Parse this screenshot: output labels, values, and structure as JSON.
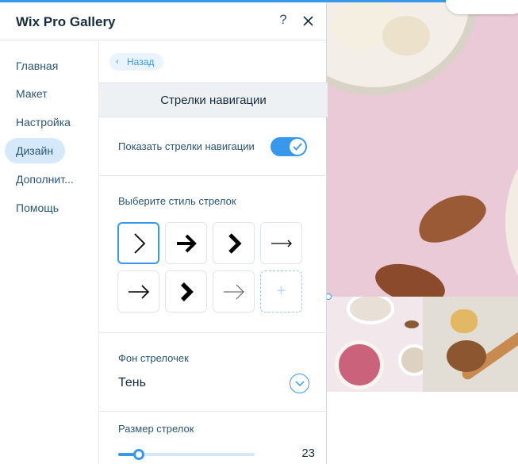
{
  "panel": {
    "title": "Wix Pro Gallery",
    "help_label": "?"
  },
  "nav": {
    "items": [
      {
        "label": "Главная"
      },
      {
        "label": "Макет"
      },
      {
        "label": "Настройка"
      },
      {
        "label": "Дизайн",
        "active": true
      },
      {
        "label": "Дополнит..."
      },
      {
        "label": "Помощь"
      }
    ]
  },
  "content": {
    "back_label": "Назад",
    "section_title": "Стрелки навигации",
    "show_arrows": {
      "label": "Показать стрелки навигации",
      "on": true
    },
    "arrow_style": {
      "label": "Выберите стиль стрелок",
      "options": [
        {
          "icon": "chevron-thin-right-icon",
          "selected": true
        },
        {
          "icon": "arrow-bold-right-icon"
        },
        {
          "icon": "chevron-bold-right-icon"
        },
        {
          "icon": "arrow-thin-long-right-icon"
        },
        {
          "icon": "arrow-medium-right-icon"
        },
        {
          "icon": "chevron-heavy-right-icon"
        },
        {
          "icon": "arrow-light-right-icon"
        },
        {
          "icon": "add-icon",
          "label": "+"
        }
      ]
    },
    "arrow_background": {
      "label": "Фон стрелочек",
      "value": "Тень"
    },
    "arrow_size": {
      "label": "Размер стрелок",
      "value": "23",
      "fraction": 0.15
    }
  },
  "colors": {
    "accent": "#3899ec",
    "text_dark": "#162d3d",
    "text_nav": "#2b5672"
  }
}
